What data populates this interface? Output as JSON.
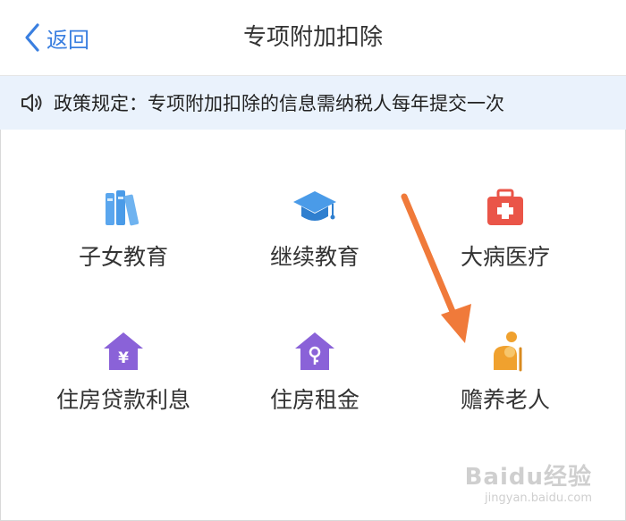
{
  "header": {
    "back_label": "返回",
    "title": "专项附加扣除"
  },
  "notice": {
    "text": "政策规定：专项附加扣除的信息需纳税人每年提交一次"
  },
  "items": [
    {
      "label": "子女教育",
      "icon": "books-icon"
    },
    {
      "label": "继续教育",
      "icon": "graduation-cap-icon"
    },
    {
      "label": "大病医疗",
      "icon": "first-aid-kit-icon"
    },
    {
      "label": "住房贷款利息",
      "icon": "house-yen-icon"
    },
    {
      "label": "住房租金",
      "icon": "house-key-icon"
    },
    {
      "label": "赡养老人",
      "icon": "elderly-person-icon"
    }
  ],
  "annotation": {
    "type": "arrow",
    "color": "#f07a3a",
    "points_to": "赡养老人"
  },
  "watermark": {
    "brand": "Baidu经验",
    "site": "jingyan.baidu.com"
  },
  "colors": {
    "accent": "#3a7fe0",
    "notice_bg": "#eaf2fc",
    "books": "#4a9be8",
    "cap": "#3e8ee0",
    "medical": "#ea5548",
    "house": "#8a62d8",
    "elderly": "#f0a12e"
  }
}
